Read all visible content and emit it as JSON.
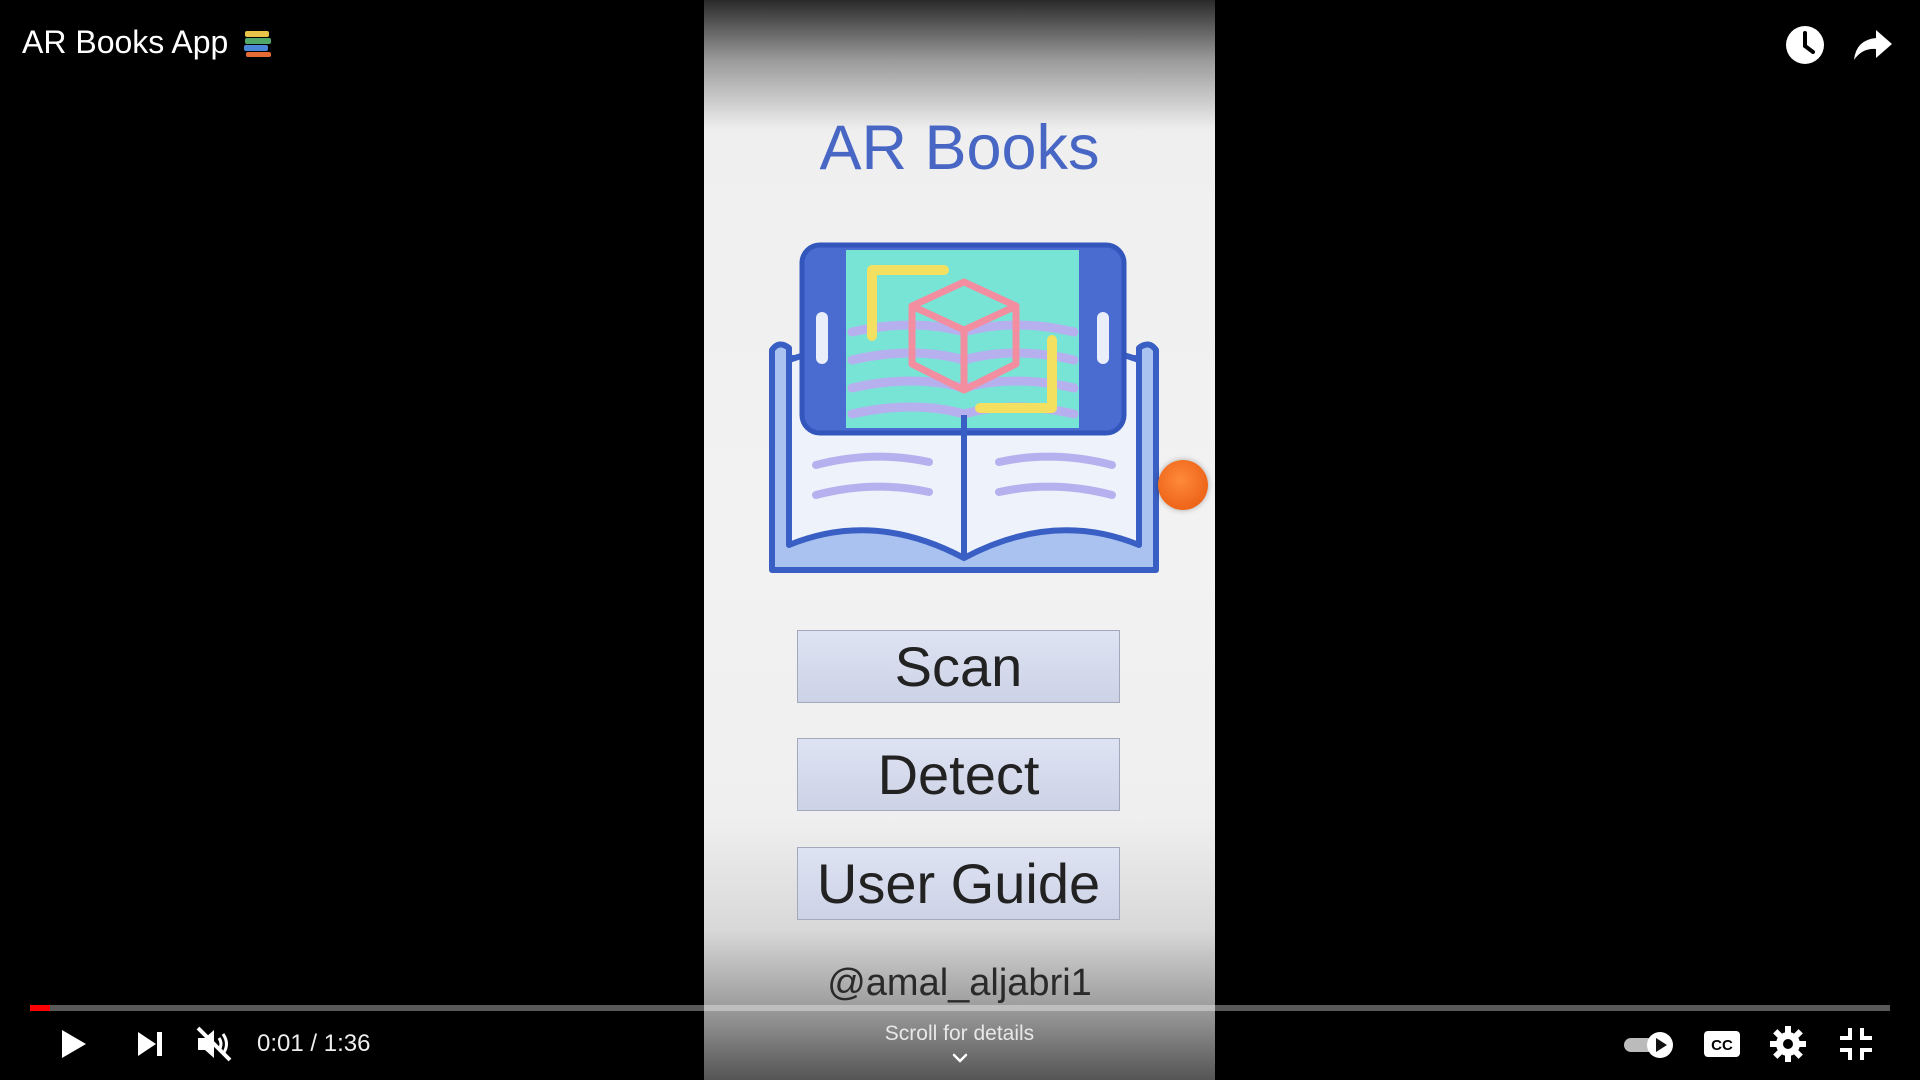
{
  "player": {
    "title": "AR Books App",
    "time_current": "0:01",
    "time_separator": "/",
    "time_total": "1:36",
    "progress_fraction": 0.011,
    "scroll_hint": "Scroll for details"
  },
  "app": {
    "name": "AR Books",
    "buttons": [
      {
        "label": "Scan"
      },
      {
        "label": "Detect"
      },
      {
        "label": "User Guide"
      }
    ],
    "handle": "@amal_aljabri1"
  },
  "icons": {
    "title_emoji": "books-icon",
    "watch_later": "clock-icon",
    "share": "share-arrow-icon",
    "play": "play-icon",
    "next": "next-icon",
    "mute": "muted-speaker-icon",
    "autoplay": "autoplay-toggle-icon",
    "captions": "cc-icon",
    "settings": "gear-icon",
    "fullscreen_exit": "exit-fullscreen-icon",
    "scroll": "chevron-down-icon"
  },
  "colors": {
    "app_title": "#4866c4",
    "progress": "#ff0000",
    "record_dot": "#f06a1e"
  }
}
